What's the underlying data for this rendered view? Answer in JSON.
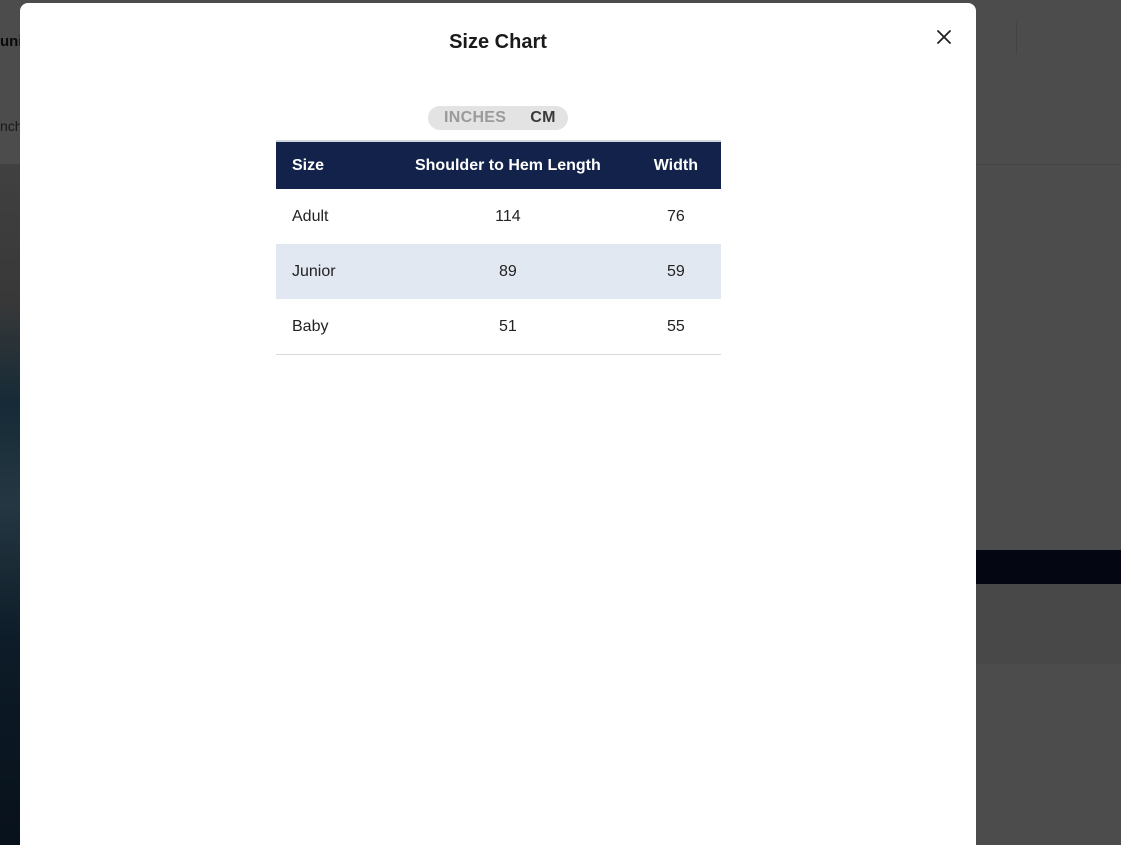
{
  "background": {
    "header_text": "uni",
    "breadcrumb_text": "nch"
  },
  "modal": {
    "title": "Size Chart",
    "close_icon": "close-icon",
    "unit_toggle": {
      "options": [
        "INCHES",
        "CM"
      ],
      "selected": "CM"
    },
    "table": {
      "headers": [
        "Size",
        "Shoulder to Hem Length",
        "Width"
      ],
      "rows": [
        {
          "size": "Adult",
          "length": "114",
          "width": "76"
        },
        {
          "size": "Junior",
          "length": "89",
          "width": "59"
        },
        {
          "size": "Baby",
          "length": "51",
          "width": "55"
        }
      ]
    }
  },
  "colors": {
    "header_bg": "#13224a",
    "alt_row_bg": "#e2e8f1",
    "toggle_bg": "#e3e3e3",
    "overlay": "rgba(0,0,0,0.70)"
  }
}
